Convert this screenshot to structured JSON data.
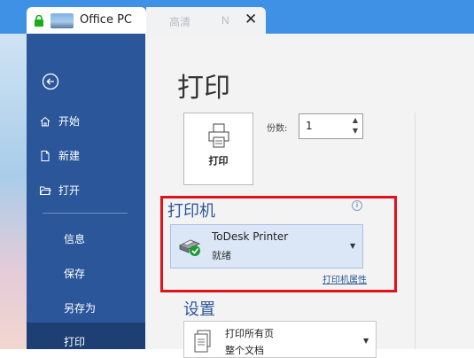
{
  "browser": {
    "active_tab": {
      "title": "Office PC"
    },
    "inactive_tab": {
      "quality": "高清",
      "n_label": "N",
      "close": "✕"
    }
  },
  "sidebar": {
    "nav": [
      {
        "label": "开始",
        "icon": "home-icon"
      },
      {
        "label": "新建",
        "icon": "new-document-icon"
      },
      {
        "label": "打开",
        "icon": "open-folder-icon"
      }
    ],
    "sub": [
      {
        "label": "信息"
      },
      {
        "label": "保存"
      },
      {
        "label": "另存为"
      },
      {
        "label": "打印",
        "active": true
      }
    ]
  },
  "main": {
    "title": "打印",
    "print_button_label": "打印",
    "copies_label": "份数:",
    "copies_value": "1",
    "printer_section": {
      "heading": "打印机",
      "printer_name": "ToDesk Printer",
      "printer_status": "就绪",
      "properties_link": "打印机属性"
    },
    "settings": {
      "heading": "设置",
      "pages_main": "打印所有页",
      "pages_sub": "整个文档"
    }
  },
  "colors": {
    "tab_strip": "#3f91e6",
    "sidebar": "#2b579a",
    "sidebar_active": "#1e3f73",
    "accent": "#2b579a",
    "highlight_border": "#e0121b",
    "printer_select_bg": "#dbe7f6"
  }
}
